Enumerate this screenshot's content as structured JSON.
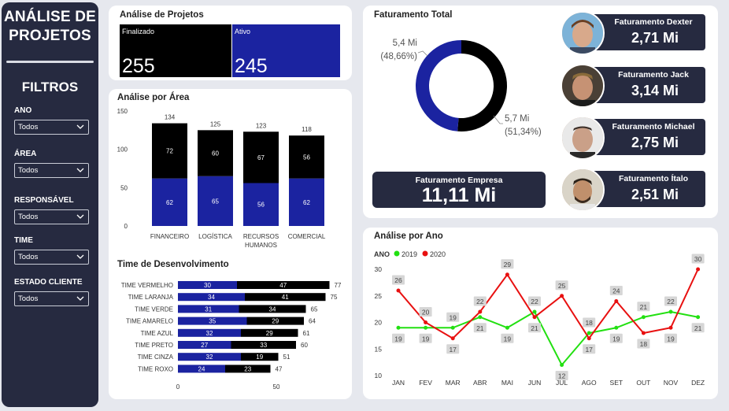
{
  "sidebar": {
    "title_line1": "ANÁLISE DE",
    "title_line2": "PROJETOS",
    "filters_title": "FILTROS",
    "filters": [
      {
        "label": "ANO",
        "value": "Todos"
      },
      {
        "label": "ÁREA",
        "value": "Todos"
      },
      {
        "label": "RESPONSÁVEL",
        "value": "Todos"
      },
      {
        "label": "TIME",
        "value": "Todos"
      },
      {
        "label": "ESTADO CLIENTE",
        "value": "Todos"
      }
    ]
  },
  "projects": {
    "title": "Análise de Projetos",
    "finalizado_label": "Finalizado",
    "finalizado_value": "255",
    "ativo_label": "Ativo",
    "ativo_value": "245"
  },
  "colors": {
    "dark": "#262a40",
    "blue": "#1b23a0",
    "black": "#000000",
    "green": "#22e011",
    "red": "#e81010"
  },
  "chart_data": [
    {
      "id": "area",
      "type": "bar",
      "title": "Análise por Área",
      "stacked": true,
      "categories": [
        "FINANCEIRO",
        "LOGÍSTICA",
        "RECURSOS HUMANOS",
        "COMERCIAL"
      ],
      "category_lines": [
        [
          "FINANCEIRO"
        ],
        [
          "LOGÍSTICA"
        ],
        [
          "RECURSOS",
          "HUMANOS"
        ],
        [
          "COMERCIAL"
        ]
      ],
      "series": [
        {
          "values": [
            62,
            65,
            56,
            62
          ],
          "color": "#1b23a0"
        },
        {
          "values": [
            72,
            60,
            67,
            56
          ],
          "color": "#000000"
        }
      ],
      "totals": [
        134,
        125,
        123,
        118
      ],
      "ylim": [
        0,
        150
      ],
      "yticks": [
        0,
        50,
        100,
        150
      ]
    },
    {
      "id": "time",
      "type": "bar",
      "orientation": "horizontal",
      "stacked": true,
      "title": "Time de Desenvolvimento",
      "categories": [
        "TIME VERMELHO",
        "TIME LARANJA",
        "TIME VERDE",
        "TIME AMARELO",
        "TIME AZUL",
        "TIME PRETO",
        "TIME CINZA",
        "TIME ROXO"
      ],
      "series": [
        {
          "values": [
            30,
            34,
            31,
            35,
            32,
            27,
            32,
            24
          ],
          "color": "#1b23a0"
        },
        {
          "values": [
            47,
            41,
            34,
            29,
            29,
            33,
            19,
            23
          ],
          "color": "#000000"
        }
      ],
      "totals": [
        77,
        75,
        65,
        64,
        61,
        60,
        51,
        47
      ],
      "xticks": [
        0,
        50
      ]
    },
    {
      "id": "donut",
      "type": "pie",
      "title": "Faturamento Total",
      "slices": [
        {
          "label": "5,7 Mi",
          "pct": "(51,34%)",
          "value": 51.34,
          "color": "#000000"
        },
        {
          "label": "5,4 Mi",
          "pct": "(48,66%)",
          "value": 48.66,
          "color": "#1b23a0"
        }
      ]
    },
    {
      "id": "ano",
      "type": "line",
      "title": "Análise por Ano",
      "legend_title": "ANO",
      "categories": [
        "JAN",
        "FEV",
        "MAR",
        "ABR",
        "MAI",
        "JUN",
        "JUL",
        "AGO",
        "SET",
        "OUT",
        "NOV",
        "DEZ"
      ],
      "series": [
        {
          "name": "2019",
          "values": [
            19,
            19,
            19,
            21,
            19,
            22,
            12,
            18,
            19,
            21,
            22,
            21
          ],
          "color": "#22e011"
        },
        {
          "name": "2020",
          "values": [
            26,
            20,
            17,
            22,
            29,
            21,
            25,
            17,
            24,
            18,
            19,
            30
          ],
          "color": "#e81010"
        }
      ],
      "ylim": [
        10,
        30
      ],
      "yticks": [
        10,
        15,
        20,
        25,
        30
      ]
    }
  ],
  "revenue": {
    "total_title": "Faturamento Total",
    "empresa_label": "Faturamento Empresa",
    "empresa_value": "11,11 Mi",
    "people": [
      {
        "label": "Faturamento Dexter",
        "value": "2,71 Mi"
      },
      {
        "label": "Faturamento Jack",
        "value": "3,14 Mi"
      },
      {
        "label": "Faturamento Michael",
        "value": "2,75 Mi"
      },
      {
        "label": "Faturamento Ítalo",
        "value": "2,51 Mi"
      }
    ]
  }
}
